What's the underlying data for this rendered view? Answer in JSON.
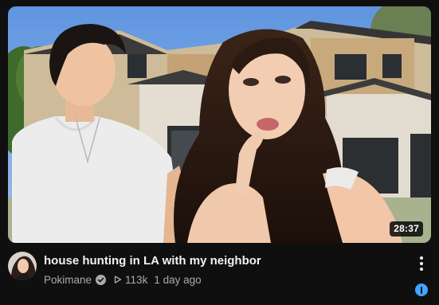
{
  "video": {
    "duration": "28:37",
    "title": "house hunting in LA with my neighbor",
    "channel": "Pokimane",
    "views": "113k",
    "age": "1 day ago"
  },
  "icons": {
    "verified": "verified-check-icon",
    "views": "play-triangle-icon",
    "more": "more-vert-icon",
    "info": "info-icon"
  },
  "colors": {
    "background": "#0f0f0f",
    "title_text": "#f1f1f1",
    "secondary_text": "#aaaaaa",
    "accent_blue": "#3ea6ff"
  }
}
